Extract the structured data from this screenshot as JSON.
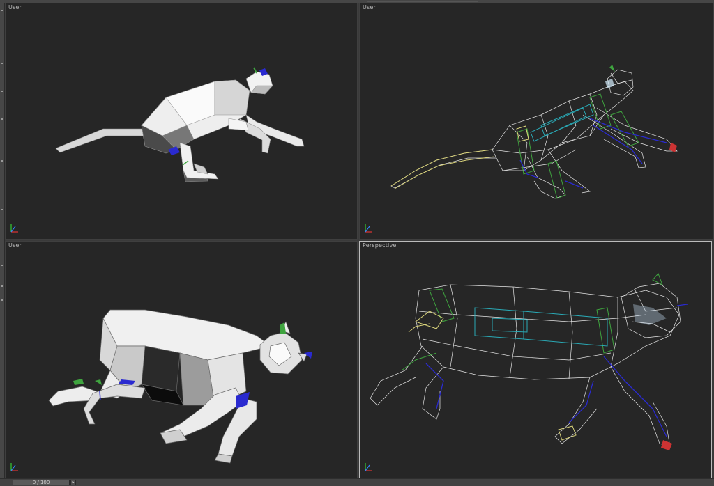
{
  "viewports": [
    {
      "id": "top-left",
      "label": "User",
      "mode": "shaded"
    },
    {
      "id": "top-right",
      "label": "User",
      "mode": "wireframe"
    },
    {
      "id": "bottom-left",
      "label": "User",
      "mode": "shaded"
    },
    {
      "id": "bottom-right",
      "label": "Perspective",
      "mode": "wireframe",
      "active": true
    }
  ],
  "timeline": {
    "frame_label": "0 / 100"
  },
  "icons": {
    "axis": "axis-gizmo-icon",
    "slider_arrow": "chevron-right-icon"
  },
  "colors": {
    "viewport_bg": "#262626",
    "active_border": "#bcbcbc",
    "mesh_light": "#e6e6e6",
    "bone_green": "#3fa43f",
    "bone_blue": "#2a2ad0",
    "bone_cyan": "#2aa9b5",
    "bone_yellow": "#d8d27a"
  }
}
